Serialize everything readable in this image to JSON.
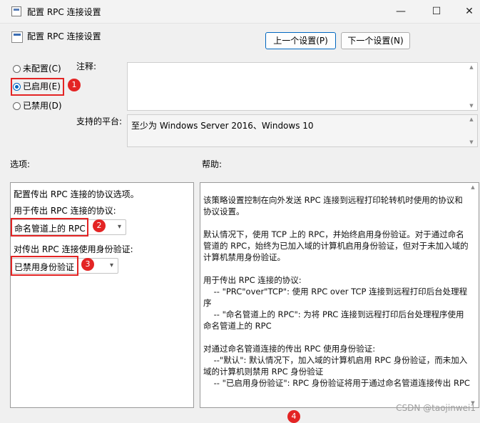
{
  "window": {
    "title": "配置 RPC 连接设置",
    "minimize": "—",
    "maximize": "☐",
    "close": "✕"
  },
  "header": {
    "title": "配置 RPC 连接设置",
    "prev_button": "上一个设置(P)",
    "next_button": "下一个设置(N)"
  },
  "state_options": [
    {
      "label": "未配置(C)",
      "selected": false
    },
    {
      "label": "已启用(E)",
      "selected": true
    },
    {
      "label": "已禁用(D)",
      "selected": false
    }
  ],
  "comment": {
    "label": "注释:",
    "value": ""
  },
  "platform": {
    "label": "支持的平台:",
    "value": "至少为 Windows Server 2016、Windows 10"
  },
  "options": {
    "section_label": "选项:",
    "description": "配置传出 RPC 连接的协议选项。",
    "protocol_label": "用于传出 RPC 连接的协议:",
    "protocol_value": "命名管道上的 RPC",
    "auth_label": "对传出 RPC 连接使用身份验证:",
    "auth_value": "已禁用身份验证"
  },
  "help": {
    "section_label": "帮助:",
    "text": "该策略设置控制在向外发送 RPC 连接到远程打印轮转机时使用的协议和协议设置。\n\n默认情况下，使用 TCP 上的 RPC，并始终启用身份验证。对于通过命名管道的 RPC，始终为已加入域的计算机启用身份验证，但对于未加入域的计算机禁用身份验证。\n\n用于传出 RPC 连接的协议:\n    -- \"PRC\"over\"TCP\": 使用 RPC over TCP 连接到远程打印后台处理程序\n    -- \"命名管道上的 RPC\": 为将 PRC 连接到远程打印后台处理程序使用命名管道上的 RPC\n\n对通过命名管道连接的传出 RPC 使用身份验证:\n    --\"默认\": 默认情况下，加入域的计算机启用 RPC 身份验证，而未加入域的计算机则禁用 RPC 身份验证\n    -- \"已启用身份验证\": RPC 身份验证将用于通过命名管道连接传出 RPC"
  },
  "callouts": [
    "1",
    "2",
    "3",
    "4"
  ],
  "watermark": "CSDN @taojinwei1",
  "colors": {
    "accent": "#0067c0",
    "highlight": "#e32424"
  }
}
